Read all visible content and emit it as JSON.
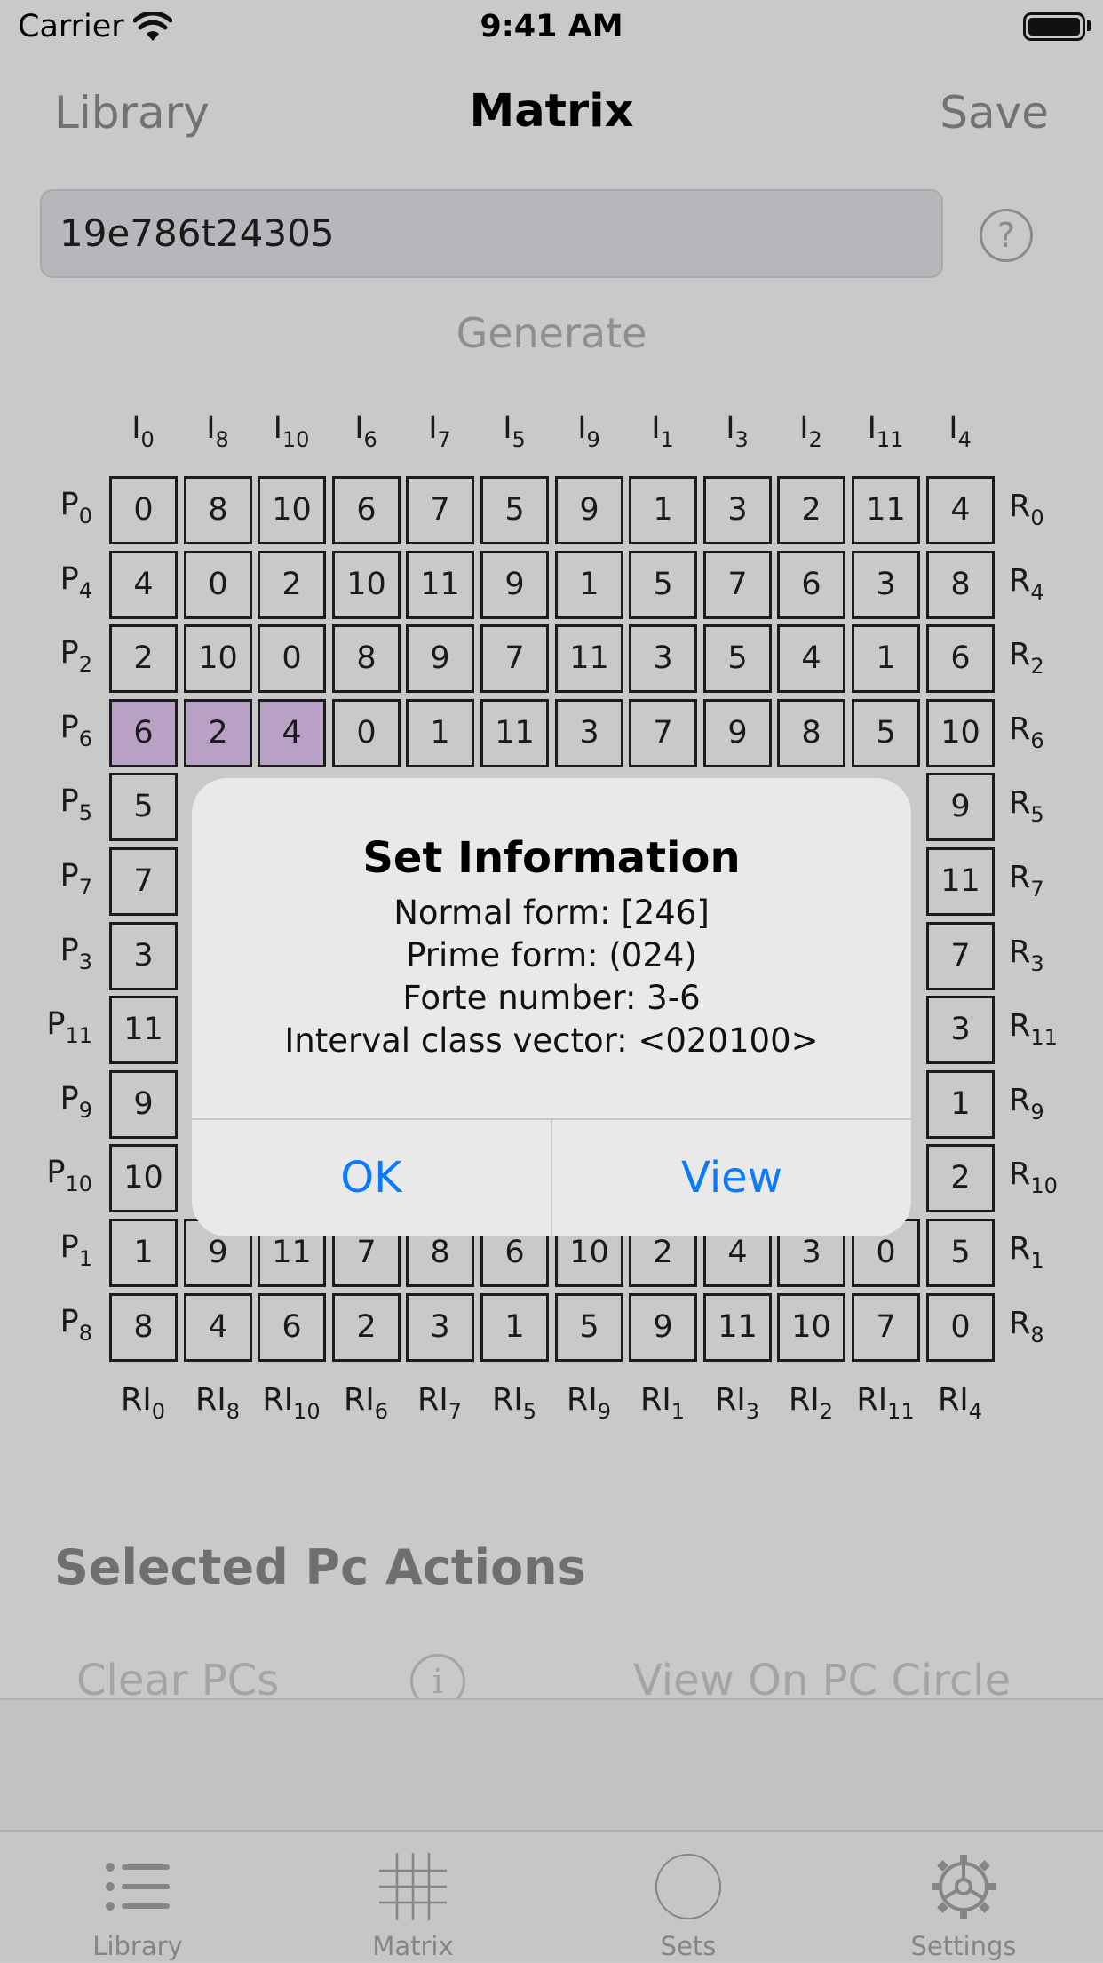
{
  "status_bar": {
    "carrier": "Carrier",
    "time": "9:41 AM"
  },
  "nav": {
    "left": "Library",
    "title": "Matrix",
    "right": "Save"
  },
  "row_input": {
    "value": "19e786t24305"
  },
  "generate_label": "Generate",
  "matrix": {
    "column_labels": [
      {
        "base": "I",
        "sub": "0"
      },
      {
        "base": "I",
        "sub": "8"
      },
      {
        "base": "I",
        "sub": "10"
      },
      {
        "base": "I",
        "sub": "6"
      },
      {
        "base": "I",
        "sub": "7"
      },
      {
        "base": "I",
        "sub": "5"
      },
      {
        "base": "I",
        "sub": "9"
      },
      {
        "base": "I",
        "sub": "1"
      },
      {
        "base": "I",
        "sub": "3"
      },
      {
        "base": "I",
        "sub": "2"
      },
      {
        "base": "I",
        "sub": "11"
      },
      {
        "base": "I",
        "sub": "4"
      }
    ],
    "row_labels": [
      {
        "base": "P",
        "sub": "0"
      },
      {
        "base": "P",
        "sub": "4"
      },
      {
        "base": "P",
        "sub": "2"
      },
      {
        "base": "P",
        "sub": "6"
      },
      {
        "base": "P",
        "sub": "5"
      },
      {
        "base": "P",
        "sub": "7"
      },
      {
        "base": "P",
        "sub": "3"
      },
      {
        "base": "P",
        "sub": "11"
      },
      {
        "base": "P",
        "sub": "9"
      },
      {
        "base": "P",
        "sub": "10"
      },
      {
        "base": "P",
        "sub": "1"
      },
      {
        "base": "P",
        "sub": "8"
      }
    ],
    "right_labels": [
      {
        "base": "R",
        "sub": "0"
      },
      {
        "base": "R",
        "sub": "4"
      },
      {
        "base": "R",
        "sub": "2"
      },
      {
        "base": "R",
        "sub": "6"
      },
      {
        "base": "R",
        "sub": "5"
      },
      {
        "base": "R",
        "sub": "7"
      },
      {
        "base": "R",
        "sub": "3"
      },
      {
        "base": "R",
        "sub": "11"
      },
      {
        "base": "R",
        "sub": "9"
      },
      {
        "base": "R",
        "sub": "10"
      },
      {
        "base": "R",
        "sub": "1"
      },
      {
        "base": "R",
        "sub": "8"
      }
    ],
    "bottom_labels": [
      {
        "base": "RI",
        "sub": "0"
      },
      {
        "base": "RI",
        "sub": "8"
      },
      {
        "base": "RI",
        "sub": "10"
      },
      {
        "base": "RI",
        "sub": "6"
      },
      {
        "base": "RI",
        "sub": "7"
      },
      {
        "base": "RI",
        "sub": "5"
      },
      {
        "base": "RI",
        "sub": "9"
      },
      {
        "base": "RI",
        "sub": "1"
      },
      {
        "base": "RI",
        "sub": "3"
      },
      {
        "base": "RI",
        "sub": "2"
      },
      {
        "base": "RI",
        "sub": "11"
      },
      {
        "base": "RI",
        "sub": "4"
      }
    ],
    "rows": [
      [
        "0",
        "8",
        "10",
        "6",
        "7",
        "5",
        "9",
        "1",
        "3",
        "2",
        "11",
        "4"
      ],
      [
        "4",
        "0",
        "2",
        "10",
        "11",
        "9",
        "1",
        "5",
        "7",
        "6",
        "3",
        "8"
      ],
      [
        "2",
        "10",
        "0",
        "8",
        "9",
        "7",
        "11",
        "3",
        "5",
        "4",
        "1",
        "6"
      ],
      [
        "6",
        "2",
        "4",
        "0",
        "1",
        "11",
        "3",
        "7",
        "9",
        "8",
        "5",
        "10"
      ],
      [
        "5",
        "",
        "",
        "",
        "",
        "",
        "",
        "",
        "",
        "",
        "",
        "9"
      ],
      [
        "7",
        "",
        "",
        "",
        "",
        "",
        "",
        "",
        "",
        "",
        "",
        "11"
      ],
      [
        "3",
        "",
        "",
        "",
        "",
        "",
        "",
        "",
        "",
        "",
        "",
        "7"
      ],
      [
        "11",
        "",
        "",
        "",
        "",
        "",
        "",
        "",
        "",
        "",
        "",
        "3"
      ],
      [
        "9",
        "",
        "",
        "",
        "",
        "",
        "",
        "",
        "",
        "",
        "",
        "1"
      ],
      [
        "10",
        "",
        "",
        "",
        "",
        "",
        "",
        "",
        "",
        "",
        "",
        "2"
      ],
      [
        "1",
        "9",
        "11",
        "7",
        "8",
        "6",
        "10",
        "2",
        "4",
        "3",
        "0",
        "5"
      ],
      [
        "8",
        "4",
        "6",
        "2",
        "3",
        "1",
        "5",
        "9",
        "11",
        "10",
        "7",
        "0"
      ]
    ],
    "highlighted": [
      [
        3,
        0
      ],
      [
        3,
        1
      ],
      [
        3,
        2
      ]
    ],
    "highlight_color": "#b9a1c6"
  },
  "dialog": {
    "title": "Set Information",
    "normal_form": "Normal form: [246]",
    "prime_form": "Prime form: (024)",
    "forte_number": "Forte number: 3-6",
    "icv": "Interval class vector: <020100>",
    "ok_label": "OK",
    "view_label": "View",
    "button_color": "#0a7aff"
  },
  "actions": {
    "title": "Selected Pc Actions",
    "clear_label": "Clear PCs",
    "view_circle_label": "View On PC Circle"
  },
  "tabbar": {
    "items": [
      {
        "label": "Library",
        "icon": "list-icon"
      },
      {
        "label": "Matrix",
        "icon": "grid-icon"
      },
      {
        "label": "Sets",
        "icon": "circle-icon"
      },
      {
        "label": "Settings",
        "icon": "gear-icon"
      }
    ]
  }
}
